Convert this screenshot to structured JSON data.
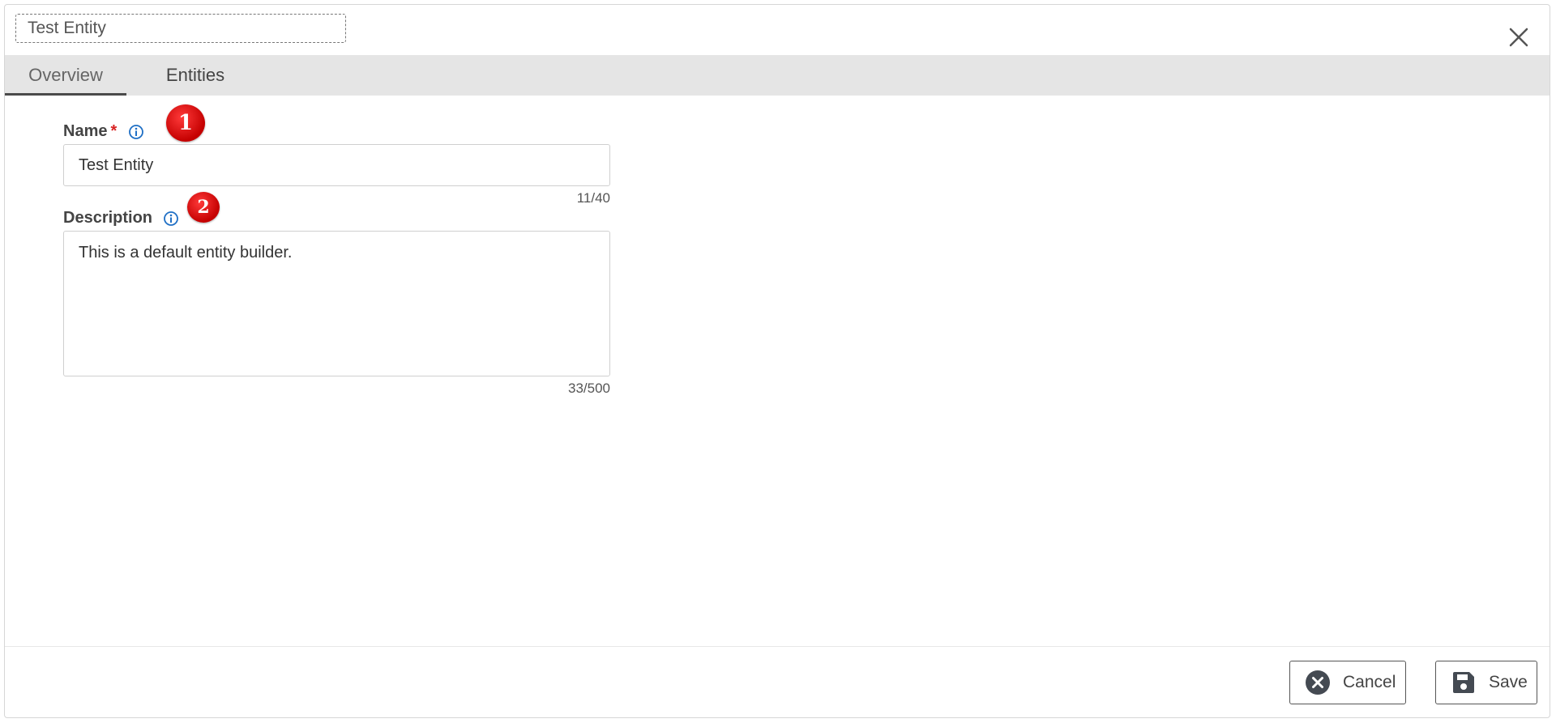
{
  "dialog": {
    "title_value": "Test Entity",
    "close_icon": "close-icon"
  },
  "tabs": [
    {
      "label": "Overview",
      "active": true
    },
    {
      "label": "Entities",
      "active": false
    }
  ],
  "form": {
    "name": {
      "label": "Name",
      "required_mark": "*",
      "value": "Test Entity",
      "counter": "11/40",
      "marker": "1"
    },
    "description": {
      "label": "Description",
      "value": "This is a default entity builder.",
      "counter": "33/500",
      "marker": "2"
    }
  },
  "footer": {
    "cancel_label": "Cancel",
    "save_label": "Save"
  },
  "colors": {
    "tab_bar": "#e5e5e5",
    "required": "#d82323",
    "info_icon": "#1f6fc5",
    "marker": "#d40000",
    "button_icon": "#444a52"
  }
}
